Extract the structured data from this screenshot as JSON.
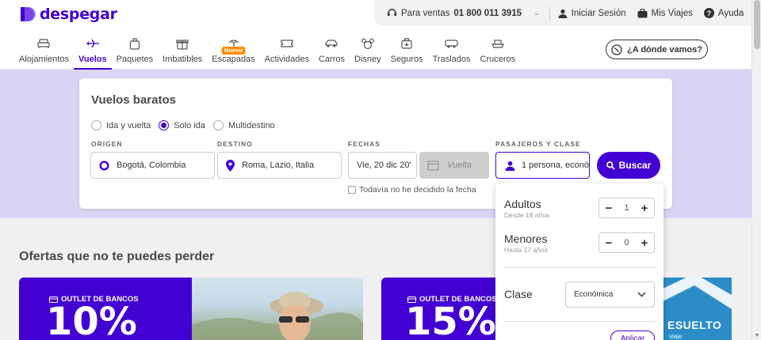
{
  "brand": {
    "name": "despegar",
    "color": "#4300d2"
  },
  "utility": {
    "sales_prefix": "Para ventas",
    "sales_phone": "01 800 011 3915",
    "login": "Iniciar Sesión",
    "trips": "Mis Viajes",
    "help": "Ayuda"
  },
  "nav": {
    "items": [
      {
        "label": "Alojamientos",
        "icon": "bed-icon"
      },
      {
        "label": "Vuelos",
        "icon": "plane-icon",
        "active": true
      },
      {
        "label": "Paquetes",
        "icon": "suitcase-icon"
      },
      {
        "label": "Imbatibles",
        "icon": "gift-icon"
      },
      {
        "label": "Escapadas",
        "icon": "palm-icon",
        "badge": "Nuevo"
      },
      {
        "label": "Actividades",
        "icon": "ticket-icon"
      },
      {
        "label": "Carros",
        "icon": "car-icon"
      },
      {
        "label": "Disney",
        "icon": "mickey-icon"
      },
      {
        "label": "Seguros",
        "icon": "medkit-icon"
      },
      {
        "label": "Traslados",
        "icon": "bus-icon"
      },
      {
        "label": "Cruceros",
        "icon": "ship-icon"
      }
    ],
    "where_label": "¿A dónde vamos?"
  },
  "search": {
    "title": "Vuelos baratos",
    "trip_types": [
      {
        "label": "Ida y vuelta",
        "selected": false
      },
      {
        "label": "Solo ida",
        "selected": true
      },
      {
        "label": "Multidestino",
        "selected": false
      }
    ],
    "labels": {
      "origin": "ORIGEN",
      "destination": "DESTINO",
      "dates": "FECHAS",
      "passengers": "PASAJEROS Y CLASE"
    },
    "origin_value": "Bogotá, Colombia",
    "destination_value": "Roma, Lazio, Italia",
    "date_value": "Vie, 20 dic 20'",
    "return_placeholder": "Vuelta",
    "passengers_value": "1 persona, econó",
    "search_button": "Buscar",
    "undecided_label": "Todavía no he decidido la fecha"
  },
  "passengers_panel": {
    "adults_label": "Adultos",
    "adults_sub": "Desde 18 años",
    "adults_count": "1",
    "minors_label": "Menores",
    "minors_sub": "Hasta 17 años",
    "minors_count": "0",
    "class_label": "Clase",
    "class_value": "Económica",
    "apply_label": "Aplicar"
  },
  "offers": {
    "title": "Ofertas que no te puedes perder",
    "promos": [
      {
        "tag": "OUTLET DE BANCOS",
        "big": "10%"
      },
      {
        "tag": "OUTLET DE BANCOS",
        "big": "15%"
      }
    ],
    "side_banner": {
      "text": "ESUELTO",
      "sub": "viaje"
    }
  }
}
